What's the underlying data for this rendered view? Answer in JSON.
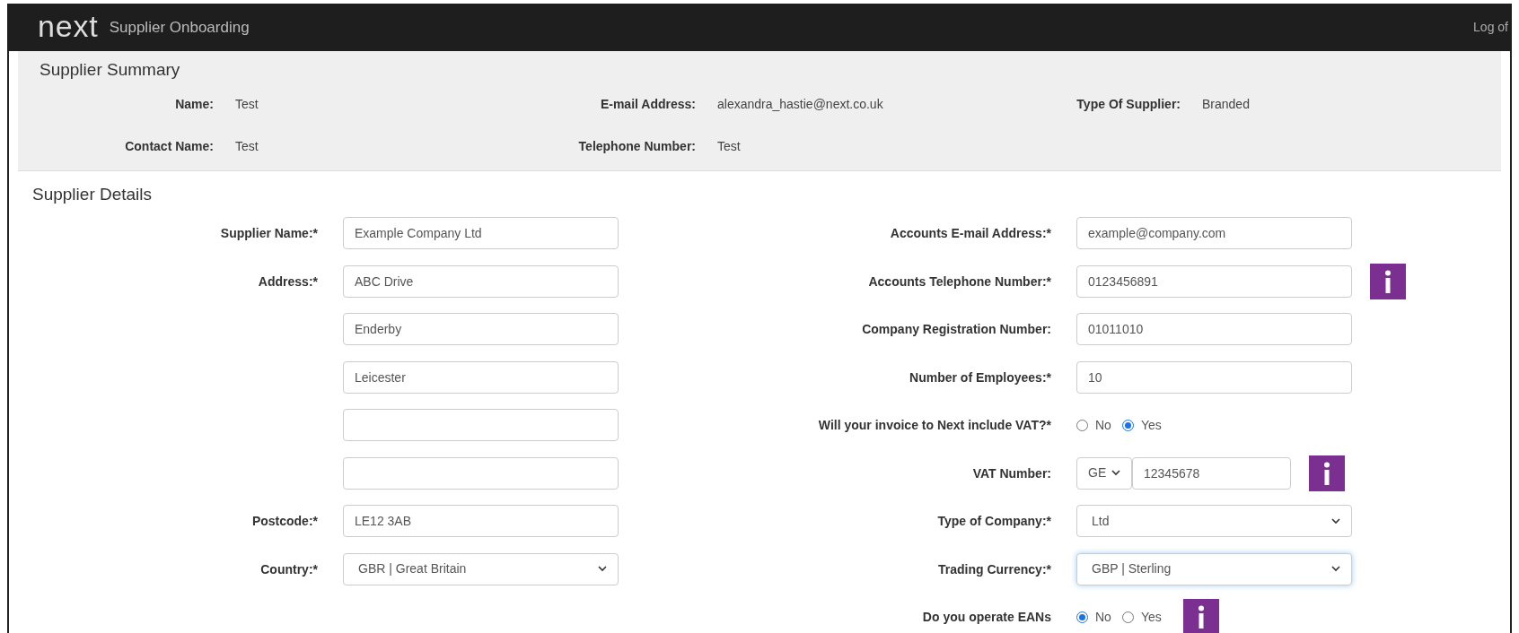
{
  "header": {
    "logo": "next",
    "title": "Supplier Onboarding",
    "logout": "Log of"
  },
  "summary": {
    "title": "Supplier Summary",
    "rows": [
      [
        {
          "label": "Name:",
          "value": "Test"
        },
        {
          "label": "E-mail Address:",
          "value": "alexandra_hastie@next.co.uk"
        },
        {
          "label": "Type Of Supplier:",
          "value": "Branded"
        }
      ],
      [
        {
          "label": "Contact Name:",
          "value": "Test"
        },
        {
          "label": "Telephone Number:",
          "value": "Test"
        }
      ]
    ]
  },
  "details": {
    "title": "Supplier Details",
    "left": [
      {
        "kind": "text",
        "label": "Supplier Name:*",
        "value": "Example Company Ltd"
      },
      {
        "kind": "text",
        "label": "Address:*",
        "value": "ABC Drive"
      },
      {
        "kind": "text",
        "value": "Enderby"
      },
      {
        "kind": "text",
        "value": "Leicester"
      },
      {
        "kind": "text"
      },
      {
        "kind": "text"
      },
      {
        "kind": "text",
        "label": "Postcode:*",
        "value": "LE12 3AB"
      },
      {
        "kind": "select",
        "label": "Country:*",
        "value": "GBR | Great Britain",
        "focused": false
      }
    ],
    "right": [
      {
        "kind": "text",
        "label": "Accounts E-mail Address:*",
        "value": "example@company.com",
        "info": false
      },
      {
        "kind": "text",
        "label": "Accounts Telephone Number:*",
        "value": "0123456891",
        "info": true
      },
      {
        "kind": "text",
        "label": "Company Registration Number:",
        "value": "01011010",
        "info": false
      },
      {
        "kind": "text",
        "label": "Number of Employees:*",
        "value": "10",
        "info": false
      },
      {
        "kind": "radio",
        "label": "Will your invoice to Next include VAT?*",
        "options": [
          {
            "label": "No",
            "selected": false
          },
          {
            "label": "Yes",
            "selected": true
          }
        ],
        "info": false
      },
      {
        "kind": "vat",
        "label": "VAT Number:",
        "prefix": "GE",
        "value": "12345678",
        "info": true
      },
      {
        "kind": "select",
        "label": "Type of Company:*",
        "value": "Ltd",
        "focused": false,
        "info": false
      },
      {
        "kind": "select",
        "label": "Trading Currency:*",
        "value": "GBP | Sterling",
        "focused": true,
        "info": false
      },
      {
        "kind": "radio",
        "label": "Do you operate EANs",
        "options": [
          {
            "label": "No",
            "selected": true
          },
          {
            "label": "Yes",
            "selected": false
          }
        ],
        "info": true
      }
    ]
  }
}
